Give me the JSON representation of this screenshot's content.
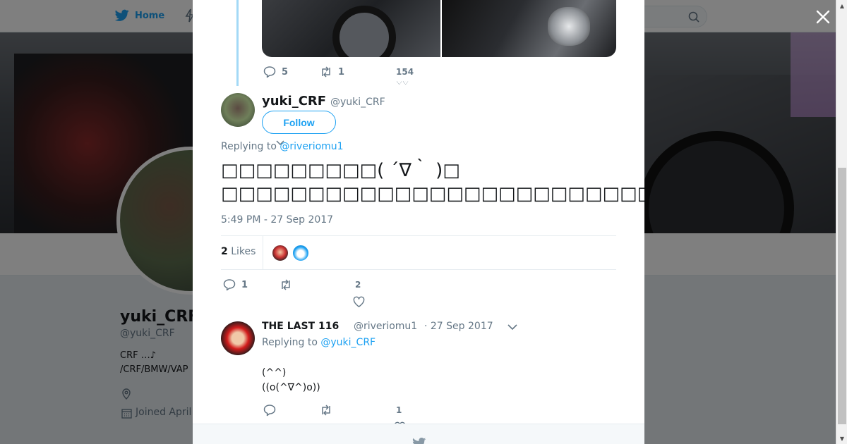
{
  "colors": {
    "accent": "#1da1f2",
    "muted": "#657786",
    "text": "#14171a",
    "thread_line": "#a3d9f6"
  },
  "background": {
    "nav": {
      "home_label": "Home",
      "home_icon": "twitter-bird-icon",
      "moments_icon": "lightning-icon",
      "search_icon": "search-icon"
    },
    "profile": {
      "name": "yuki_CRF",
      "handle": "@yuki_CRF",
      "bio_line1": "CRF …♪",
      "bio_line2": "/CRF/BMW/VAP",
      "location_icon": "location-pin-icon",
      "joined_icon": "calendar-icon",
      "joined_text": "Joined April"
    }
  },
  "close_icon": "close-icon",
  "previous_tweet": {
    "reply_count": "5",
    "retweet_count": "1",
    "like_count": "154"
  },
  "main_tweet": {
    "name": "yuki_CRF",
    "handle": "@yuki_CRF",
    "follow_label": "Follow",
    "replying_prefix": "Replying to",
    "replying_to": "@riveriomu1",
    "text_line1": "□□□□□□□□□( ´∇｀ )□",
    "text_line2": "□□□□□□□□□□□□□□□□□□□□□□□□□□□□□□□(□˃̶‿˂̶)",
    "timestamp": "5:49 PM - 27 Sep 2017",
    "likes_number": "2",
    "likes_word": "Likes",
    "reply_count": "1",
    "retweet_count": "",
    "like_count": "2"
  },
  "reply_tweet": {
    "name": "THE LAST 116",
    "handle": "@riveriomu1",
    "date": "· 27 Sep 2017",
    "replying_prefix": "Replying to",
    "replying_to": "@yuki_CRF",
    "line1": "(^^)",
    "line2": "((o(^∇^)o))",
    "reply_count": "",
    "retweet_count": "",
    "like_count": "1"
  }
}
